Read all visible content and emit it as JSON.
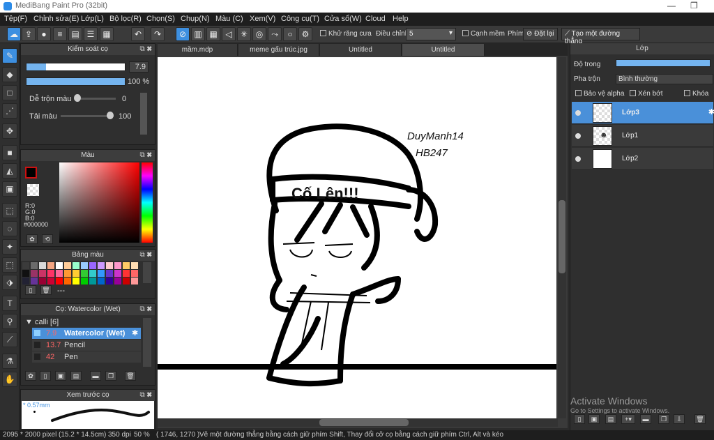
{
  "window": {
    "title": "MediBang Paint Pro (32bit)",
    "minimize": "—",
    "restore": "❐"
  },
  "menu": [
    "Tệp(F)",
    "Chỉnh sửa(E)",
    "Lớp(L)",
    "Bộ lọc(R)",
    "Chọn(S)",
    "Chụp(N)",
    "Màu (C)",
    "Xem(V)",
    "Công cụ(T)",
    "Cửa sổ(W)",
    "Cloud",
    "Help"
  ],
  "toolbar": {
    "antialias_label": "Khử răng cưa",
    "adjust_label": "Điều chỉnh",
    "adjust_value": "5",
    "snap_label": "Cạnh mềm",
    "key_label": "Phím",
    "reset_label": "Đặt lại",
    "make_line_label": "Tạo một đường thẳng"
  },
  "brush_control": {
    "title": "Kiểm soát cọ",
    "size_value": "7.9",
    "opacity_value": "100 %",
    "blend_label": "Dễ trộn màu",
    "blend_value": "0",
    "reload_label": "Tải màu",
    "reload_value": "100",
    "size_fill": 0.2,
    "opacity_fill": 1.0
  },
  "color_panel": {
    "title": "Màu",
    "r": "R:0",
    "g": "G:0",
    "b": "B:0",
    "hex": "#000000",
    "fg_color": "#000000",
    "accent": "#cc1111"
  },
  "palette": {
    "title": "Bảng màu",
    "more": "---",
    "colors": [
      "#3b3b3b",
      "#6b6b6b",
      "#d9d9d9",
      "#f4a582",
      "#ffffff",
      "#ffcc99",
      "#99ffcc",
      "#99ccff",
      "#9966ff",
      "#cc99ff",
      "#ffcccc",
      "#ff99cc",
      "#ffcc66",
      "#ffddb3",
      "#111111",
      "#993366",
      "#cc3366",
      "#ff3366",
      "#ff6699",
      "#ff9933",
      "#ffcc33",
      "#33cc33",
      "#33cccc",
      "#3399ff",
      "#6633cc",
      "#cc33cc",
      "#ff3333",
      "#ff6666",
      "#222233",
      "#663399",
      "#990033",
      "#cc0033",
      "#ff0000",
      "#ff6600",
      "#ffff00",
      "#00cc00",
      "#009999",
      "#0066cc",
      "#330099",
      "#990099",
      "#cc0000",
      "#ff9999"
    ]
  },
  "brush_list": {
    "title": "Cọ: Watercolor (Wet)",
    "group": "calli [6]",
    "items": [
      {
        "size": "7.9",
        "name": "Watercolor (Wet)"
      },
      {
        "size": "13.7",
        "name": "Pencil"
      },
      {
        "size": "42",
        "name": "Pen"
      }
    ]
  },
  "preview": {
    "title": "Xem trước cọ",
    "size": "* 0.57mm"
  },
  "tabs": [
    "mầm.mdp",
    "meme gấu trúc.jpg",
    "Untitled",
    "Untitled"
  ],
  "canvas_text": {
    "signature_line1": "DuyManh14",
    "signature_line2": "HB247",
    "headband": "Cố Lên!!!"
  },
  "layers_panel": {
    "title": "Lớp",
    "opacity_label": "Độ trong",
    "blend_label": "Pha trộn",
    "blend_value": "Bình thường",
    "protect_alpha": "Bảo vệ alpha",
    "clipping": "Xén bớt",
    "lock": "Khóa",
    "layers": [
      "Lớp3",
      "Lớp1",
      "Lớp2"
    ]
  },
  "watermark": {
    "line1": "Activate Windows",
    "line2": "Go to Settings to activate Windows."
  },
  "status": {
    "size": "2095 * 2000 pixel",
    "physical": "(15.2 * 14.5cm)",
    "dpi": "350 dpi",
    "zoom": "50 %",
    "coords": "( 1746, 1270 )",
    "hint": "Vẽ một đường thẳng bằng cách giữ phím Shift, Thay đổi cỡ cọ bằng cách giữ phím Ctrl, Alt và kéo"
  }
}
